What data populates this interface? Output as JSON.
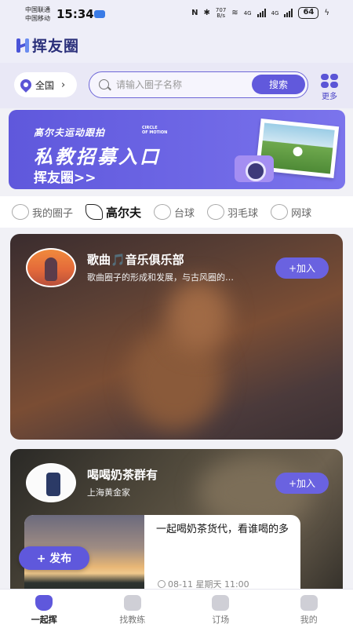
{
  "status_bar": {
    "carrier1": "中国联通",
    "carrier2": "中国移动",
    "time": "15:34",
    "net_speed_value": "707",
    "net_speed_unit": "B/s",
    "battery": "64",
    "signal1": "4G",
    "signal2": "4G"
  },
  "app": {
    "logo_text": "挥友圈"
  },
  "search": {
    "region": "全国",
    "placeholder": "请输入圈子名称",
    "button": "搜索",
    "more_label": "更多"
  },
  "banner": {
    "subtitle": "高尔夫运动跟拍",
    "caption_en": [
      "CIRCLE",
      "OF MOTION"
    ],
    "title": "私教招募入口",
    "brand": "挥友圈>>"
  },
  "categories": [
    {
      "label": "我的圈子",
      "icon": "circle-icon",
      "active": false
    },
    {
      "label": "高尔夫",
      "icon": "golf-club-icon",
      "active": true
    },
    {
      "label": "台球",
      "icon": "billiards-icon",
      "active": false
    },
    {
      "label": "羽毛球",
      "icon": "badminton-icon",
      "active": false
    },
    {
      "label": "网球",
      "icon": "tennis-icon",
      "active": false
    }
  ],
  "cards": [
    {
      "name": "歌曲🎵音乐俱乐部",
      "desc": "歌曲圈子的形成和发展，与古风圈的…",
      "join": "+加入"
    },
    {
      "name": "喝喝奶茶群有",
      "desc": "上海黄金家",
      "join": "+加入",
      "post": {
        "title": "一起喝奶茶货代，看谁喝的多",
        "time": "08-11 星期天 11:00"
      }
    }
  ],
  "fab": {
    "label": "+ 发布"
  },
  "bottom_nav": [
    {
      "label": "一起挥",
      "icon": "home-icon",
      "active": true
    },
    {
      "label": "找教练",
      "icon": "coach-icon",
      "active": false
    },
    {
      "label": "订场",
      "icon": "venue-icon",
      "active": false
    },
    {
      "label": "我的",
      "icon": "profile-icon",
      "active": false
    }
  ],
  "colors": {
    "accent": "#5f58dc",
    "header_bg": "#eeeef8"
  }
}
